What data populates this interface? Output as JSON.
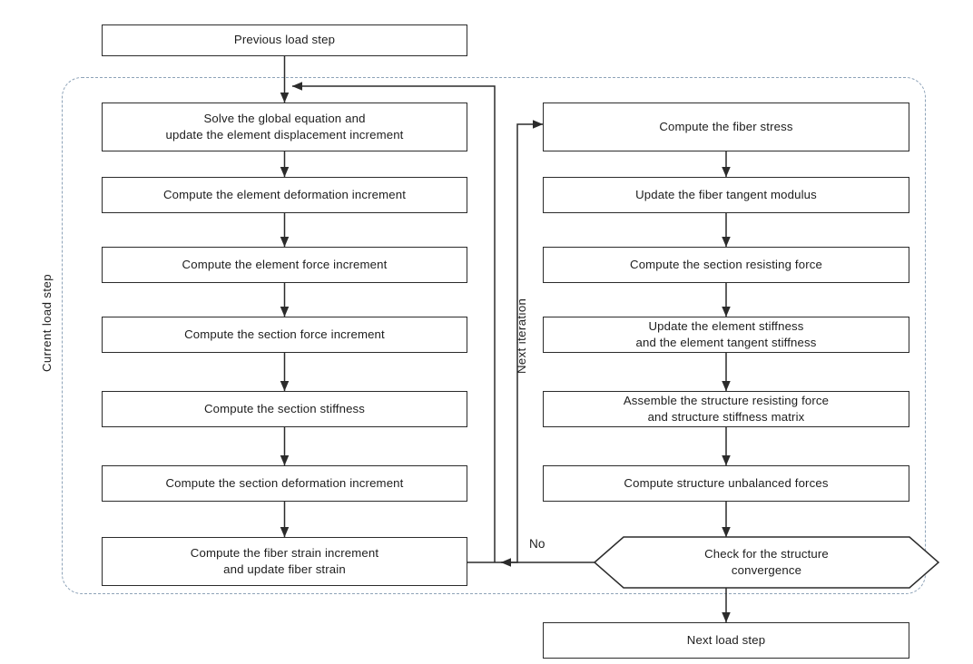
{
  "diagram": {
    "title": "Fiber-section nonlinear analysis flowchart",
    "type": "flowchart",
    "colors": {
      "box_border": "#2b2b2b",
      "connector": "#2b2b2b",
      "dashed_region": "#8ea3b8",
      "background": "#ffffff",
      "text": "#1d1d1d"
    }
  },
  "nodes": {
    "previous_load_step": "Previous load step",
    "left_column": [
      "Solve the global equation and\nupdate the element displacement increment",
      "Compute the element deformation increment",
      "Compute the element force increment",
      "Compute the section force increment",
      "Compute the section stiffness",
      "Compute the section deformation increment",
      "Compute the fiber strain increment\nand update fiber strain"
    ],
    "right_column": [
      "Compute the fiber stress",
      "Update the fiber tangent modulus",
      "Compute the section resisting force",
      "Update the element stiffness\nand the element tangent stiffness",
      "Assemble the structure resisting force\nand structure stiffness matrix",
      "Compute structure unbalanced forces"
    ],
    "decision": "Check for the structure\nconvergence",
    "next_load_step": "Next load step"
  },
  "labels": {
    "current_load_step": "Current load step",
    "next_iteration": "Next iteration",
    "no_branch": "No"
  }
}
